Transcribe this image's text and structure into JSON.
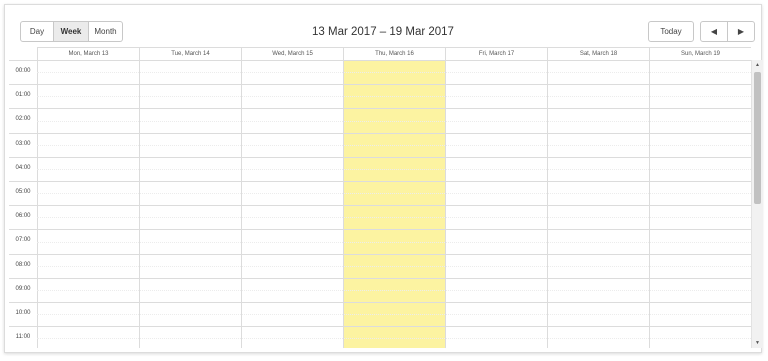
{
  "toolbar": {
    "views": [
      {
        "label": "Day",
        "active": false
      },
      {
        "label": "Week",
        "active": true
      },
      {
        "label": "Month",
        "active": false
      }
    ],
    "title": "13 Mar 2017 – 19 Mar 2017",
    "today_label": "Today",
    "prev_icon": "◀",
    "next_icon": "▶"
  },
  "days": [
    {
      "label": "Mon, March 13",
      "today": false
    },
    {
      "label": "Tue, March 14",
      "today": false
    },
    {
      "label": "Wed, March 15",
      "today": false
    },
    {
      "label": "Thu, March 16",
      "today": true
    },
    {
      "label": "Fri, March 17",
      "today": false
    },
    {
      "label": "Sat, March 18",
      "today": false
    },
    {
      "label": "Sun, March 19",
      "today": false
    }
  ],
  "hours": [
    "00:00",
    "01:00",
    "02:00",
    "03:00",
    "04:00",
    "05:00",
    "06:00",
    "07:00",
    "08:00",
    "09:00",
    "10:00",
    "11:00"
  ],
  "colors": {
    "today_highlight": "#fcf3a1",
    "grid_line": "#dcdcdc",
    "active_button": "#ebebeb"
  },
  "scrollbar": {
    "up_icon": "▲",
    "down_icon": "▼"
  }
}
